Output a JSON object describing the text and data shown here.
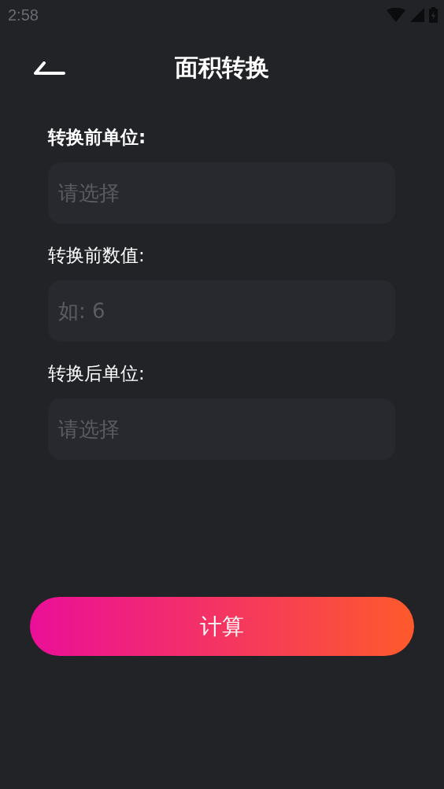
{
  "status_bar": {
    "time": "2:58"
  },
  "header": {
    "title": "面积转换"
  },
  "fields": [
    {
      "label": "转换前单位:",
      "placeholder": "请选择",
      "selected": true
    },
    {
      "label": "转换前数值:",
      "placeholder": "如: 6",
      "selected": false
    },
    {
      "label": "转换后单位:",
      "placeholder": "请选择",
      "selected": false
    }
  ],
  "button": {
    "label": "计算"
  }
}
